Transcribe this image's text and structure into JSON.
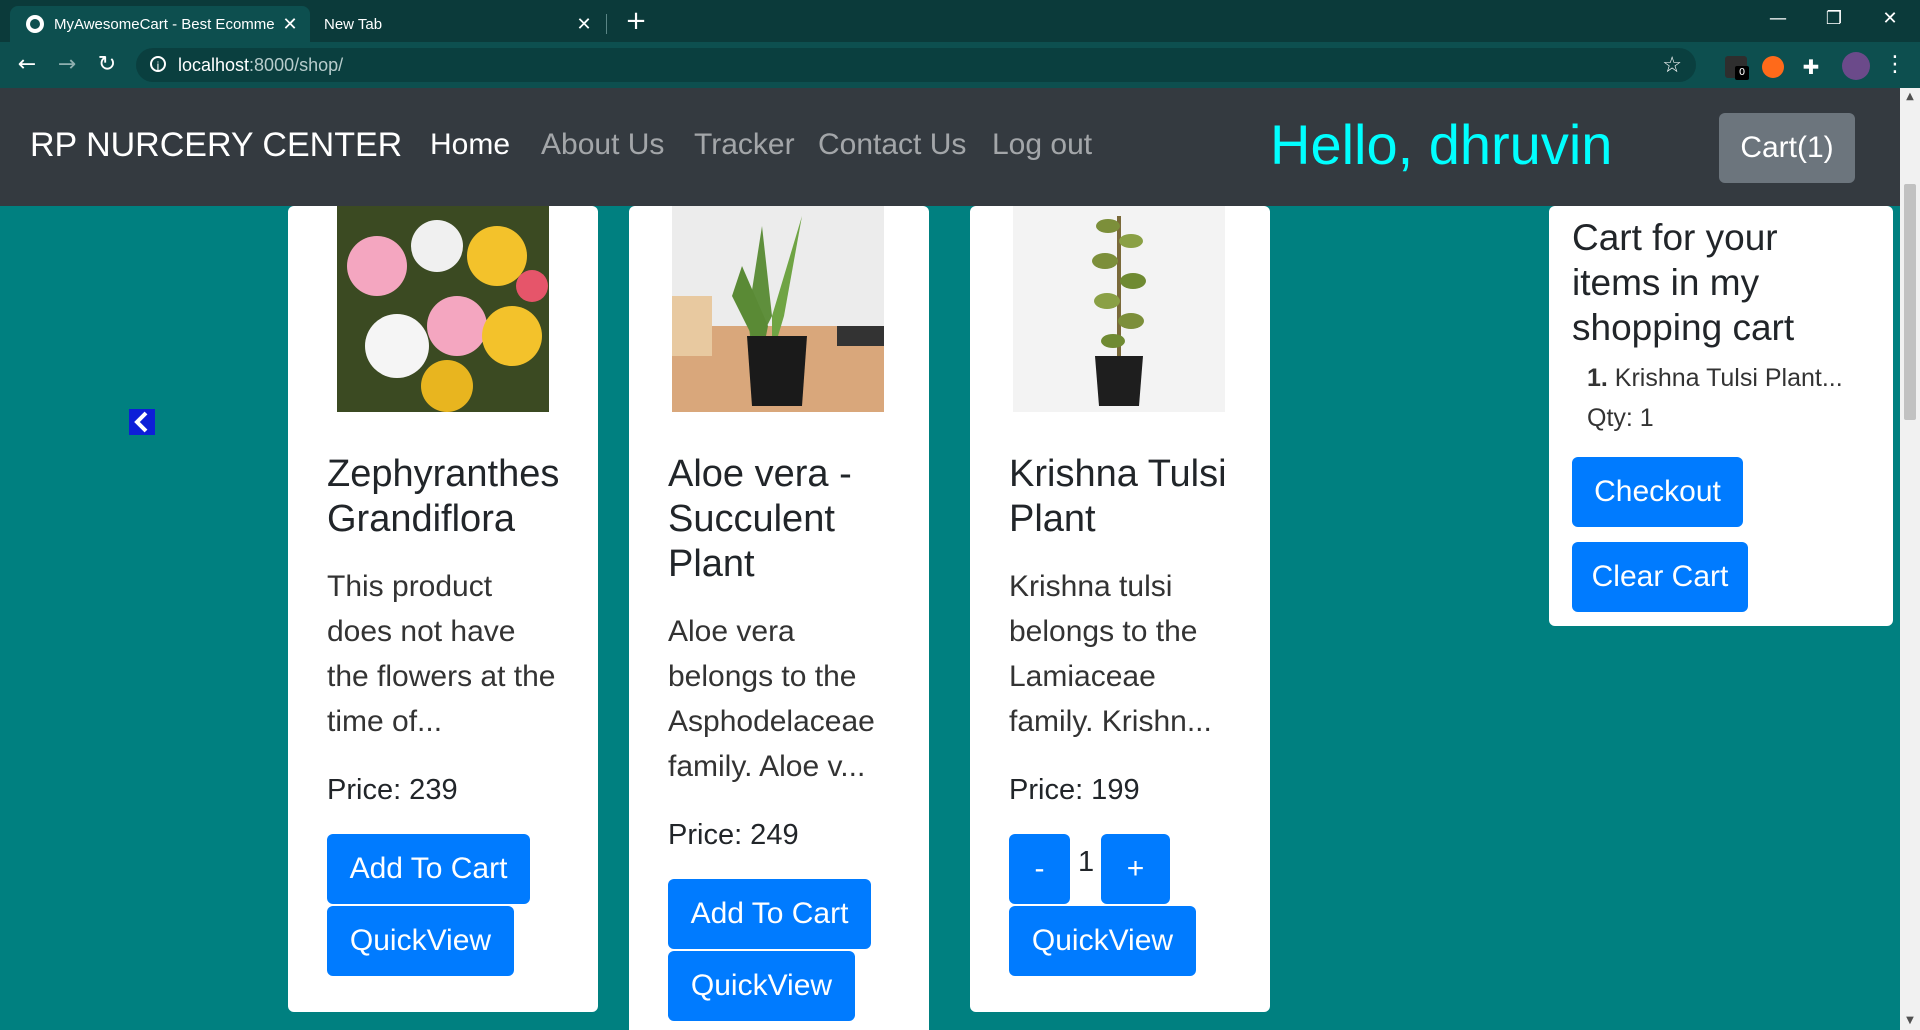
{
  "browser": {
    "tabs": [
      {
        "title": "MyAwesomeCart - Best Ecomme"
      },
      {
        "title": "New Tab"
      }
    ],
    "url_host": "localhost",
    "url_path": ":8000/shop/",
    "extension_badge": "0"
  },
  "nav": {
    "brand": "RP NURCERY CENTER",
    "links": [
      "Home",
      "About Us",
      "Tracker",
      "Contact Us",
      "Log out"
    ],
    "greeting": "Hello, dhruvin",
    "cart_button": "Cart(1)"
  },
  "products": [
    {
      "title_lines": [
        "Zephyranthes",
        "Grandiflora"
      ],
      "desc_lines": [
        "This product",
        "does not have",
        "the flowers at the",
        "time of..."
      ],
      "price": "Price: 239",
      "add_label": "Add To Cart",
      "quickview_label": "QuickView"
    },
    {
      "title_lines": [
        "Aloe vera -",
        "Succulent",
        "Plant"
      ],
      "desc_lines": [
        "Aloe vera",
        "belongs to the",
        "Asphodelaceae",
        "family. Aloe v..."
      ],
      "price": "Price: 249",
      "add_label": "Add To Cart",
      "quickview_label": "QuickView"
    },
    {
      "title_lines": [
        "Krishna Tulsi",
        "Plant"
      ],
      "desc_lines": [
        "Krishna tulsi",
        "belongs to the",
        "Lamiaceae",
        "family. Krishn..."
      ],
      "price": "Price: 199",
      "minus_label": "-",
      "qty": "1",
      "plus_label": "+",
      "quickview_label": "QuickView"
    }
  ],
  "cart_panel": {
    "title": "Cart for your items in my shopping cart",
    "item_number": "1.",
    "item_name": " Krishna Tulsi Plant...",
    "qty": "Qty: 1",
    "checkout_label": "Checkout",
    "clear_label": "Clear Cart"
  },
  "colors": {
    "page_bg": "#008080",
    "navbar_bg": "#343a40",
    "greeting": "#00ffff",
    "primary_button": "#007bff",
    "cart_button": "#6c757d"
  }
}
